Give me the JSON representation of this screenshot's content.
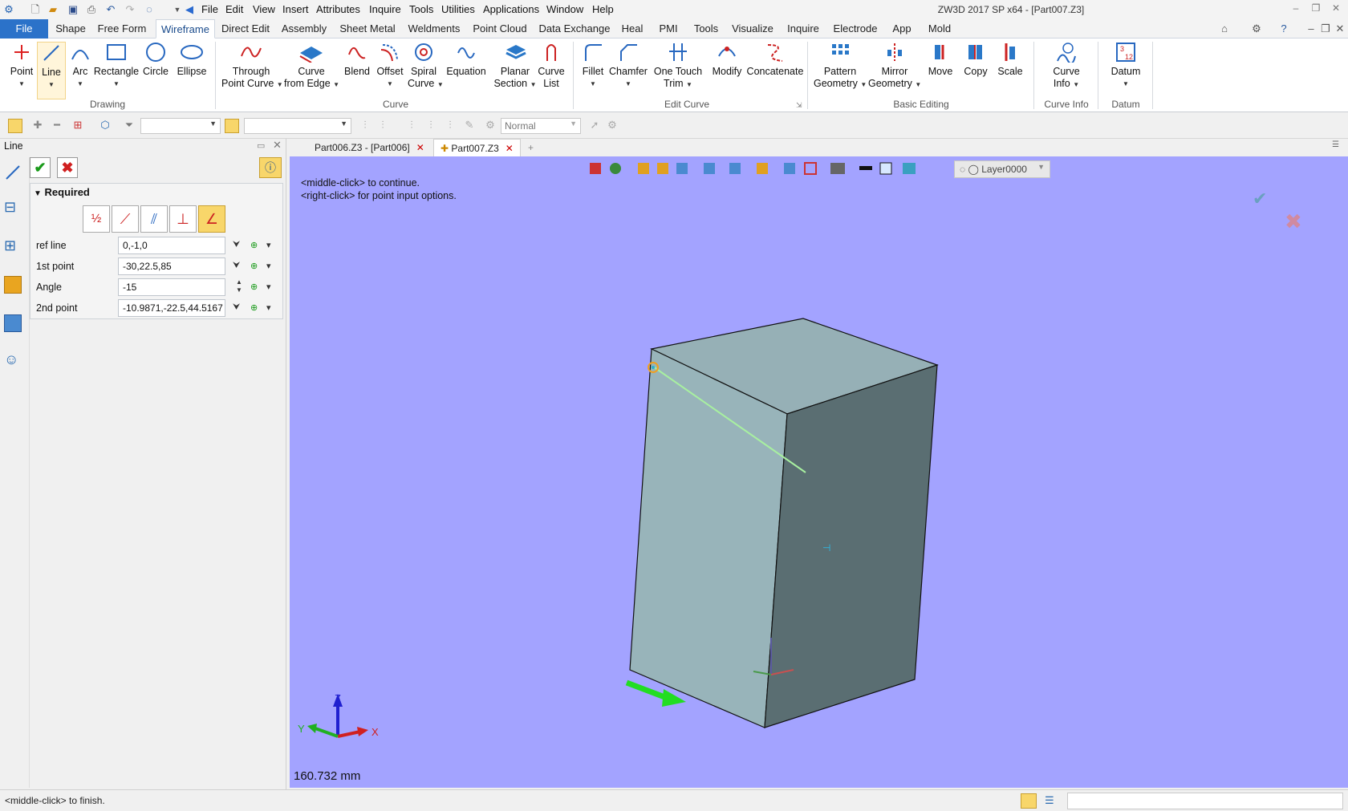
{
  "title_bar": {
    "window_title": "ZW3D 2017 SP x64 - [Part007.Z3]",
    "menu": [
      "File",
      "Edit",
      "View",
      "Insert",
      "Attributes",
      "Inquire",
      "Tools",
      "Utilities",
      "Applications",
      "Window",
      "Help"
    ]
  },
  "ribbon_tabs": [
    "File",
    "Shape",
    "Free Form",
    "Wireframe",
    "Direct Edit",
    "Assembly",
    "Sheet Metal",
    "Weldments",
    "Point Cloud",
    "Data Exchange",
    "Heal",
    "PMI",
    "Tools",
    "Visualize",
    "Inquire",
    "Electrode",
    "App",
    "Mold"
  ],
  "ribbon": {
    "drawing": {
      "group_label": "Drawing",
      "buttons": [
        "Point",
        "Line",
        "Arc",
        "Rectangle",
        "Circle",
        "Ellipse"
      ]
    },
    "curve": {
      "group_label": "Curve",
      "buttons": [
        [
          "Through",
          "Point Curve"
        ],
        [
          "Curve",
          "from Edge"
        ],
        [
          "Blend",
          ""
        ],
        [
          "Offset",
          ""
        ],
        [
          "Spiral",
          "Curve"
        ],
        [
          "Equation",
          ""
        ],
        [
          "Planar",
          "Section"
        ],
        [
          "Curve",
          "List"
        ]
      ]
    },
    "edit_curve": {
      "group_label": "Edit Curve",
      "buttons": [
        [
          "Fillet",
          ""
        ],
        [
          "Chamfer",
          ""
        ],
        [
          "One Touch",
          "Trim"
        ],
        [
          "Modify",
          ""
        ],
        [
          "Concatenate",
          ""
        ]
      ]
    },
    "basic_editing": {
      "group_label": "Basic Editing",
      "buttons": [
        [
          "Pattern",
          "Geometry"
        ],
        [
          "Mirror",
          "Geometry"
        ],
        [
          "Move",
          ""
        ],
        [
          "Copy",
          ""
        ],
        [
          "Scale",
          ""
        ]
      ]
    },
    "curve_info": {
      "group_label": "Curve Info",
      "buttons": [
        [
          "Curve",
          "Info"
        ]
      ]
    },
    "datum": {
      "group_label": "Datum",
      "buttons": [
        [
          "Datum",
          ""
        ]
      ]
    }
  },
  "toolbar": {
    "render_mode": "Normal"
  },
  "doc_tabs": {
    "tab1": "Part006.Z3 - [Part006]",
    "tab2": "Part007.Z3"
  },
  "panel": {
    "title": "Line",
    "section": "Required",
    "fields": {
      "ref_line": {
        "label": "ref line",
        "value": "0,-1,0"
      },
      "first_point": {
        "label": "1st point",
        "value": "-30,22.5,85"
      },
      "angle": {
        "label": "Angle",
        "value": "-15"
      },
      "second_point": {
        "label": "2nd point",
        "value": "-10.9871,-22.5,44.5167"
      }
    }
  },
  "viewport": {
    "hint1": "<middle-click> to continue.",
    "hint2": "<right-click> for point input options.",
    "scale": "160.732 mm",
    "layer": "Layer0000",
    "axis_labels": {
      "z": "Z",
      "y": "Y",
      "x": "X"
    },
    "background_color": "#a3a3ff"
  },
  "status": {
    "message": "<middle-click> to finish."
  }
}
